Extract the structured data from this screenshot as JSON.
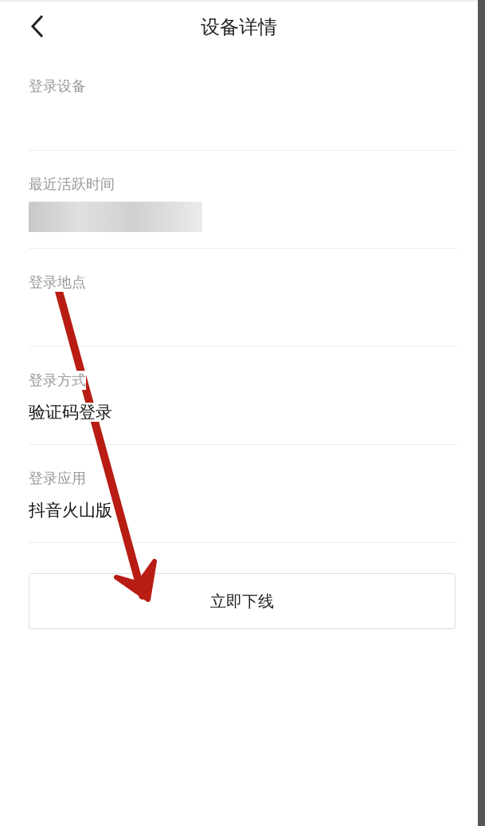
{
  "header": {
    "title": "设备详情"
  },
  "fields": [
    {
      "label": "登录设备",
      "kind": "empty"
    },
    {
      "label": "最近活跃时间",
      "kind": "redacted"
    },
    {
      "label": "登录地点",
      "kind": "empty"
    },
    {
      "label": "登录方式",
      "kind": "text",
      "value": "验证码登录"
    },
    {
      "label": "登录应用",
      "kind": "text",
      "value": "抖音火山版"
    }
  ],
  "action_button": {
    "label": "立即下线"
  }
}
